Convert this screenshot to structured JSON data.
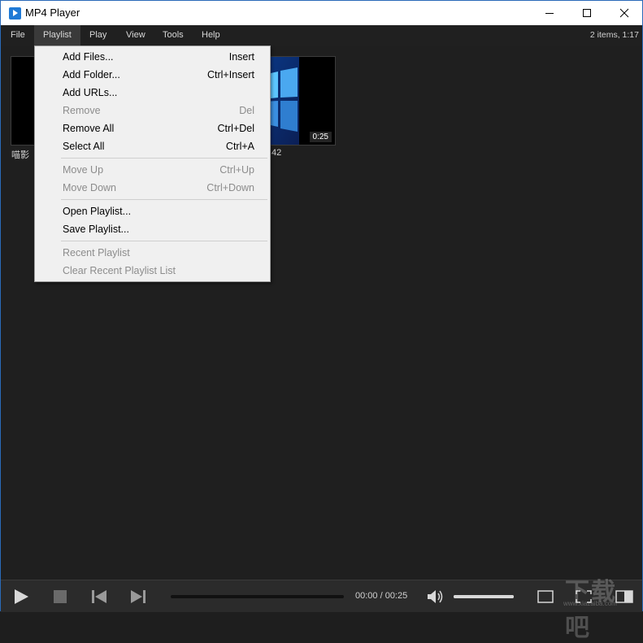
{
  "window": {
    "title": "MP4 Player"
  },
  "menubar": {
    "items": [
      "File",
      "Playlist",
      "Play",
      "View",
      "Tools",
      "Help"
    ],
    "status": "2 items, 1:17"
  },
  "thumbnails": [
    {
      "label": "喵影",
      "duration": ""
    },
    {
      "label": "42",
      "duration": "0:25"
    }
  ],
  "playlist_menu": {
    "items": [
      {
        "label": "Add Files...",
        "shortcut": "Insert",
        "enabled": true
      },
      {
        "label": "Add Folder...",
        "shortcut": "Ctrl+Insert",
        "enabled": true
      },
      {
        "label": "Add URLs...",
        "shortcut": "",
        "enabled": true
      },
      {
        "label": "Remove",
        "shortcut": "Del",
        "enabled": false
      },
      {
        "label": "Remove All",
        "shortcut": "Ctrl+Del",
        "enabled": true
      },
      {
        "label": "Select All",
        "shortcut": "Ctrl+A",
        "enabled": true
      },
      {
        "label": "Move Up",
        "shortcut": "Ctrl+Up",
        "enabled": false
      },
      {
        "label": "Move Down",
        "shortcut": "Ctrl+Down",
        "enabled": false
      },
      {
        "label": "Open Playlist...",
        "shortcut": "",
        "enabled": true
      },
      {
        "label": "Save Playlist...",
        "shortcut": "",
        "enabled": true
      },
      {
        "label": "Recent Playlist",
        "shortcut": "",
        "enabled": false
      },
      {
        "label": "Clear Recent Playlist List",
        "shortcut": "",
        "enabled": false
      }
    ]
  },
  "controls": {
    "time": "00:00 / 00:25",
    "seek_progress": 0,
    "volume_level": 1.0
  },
  "watermark": {
    "text": "下载吧",
    "url_text": "www.xiazaiba.com"
  }
}
